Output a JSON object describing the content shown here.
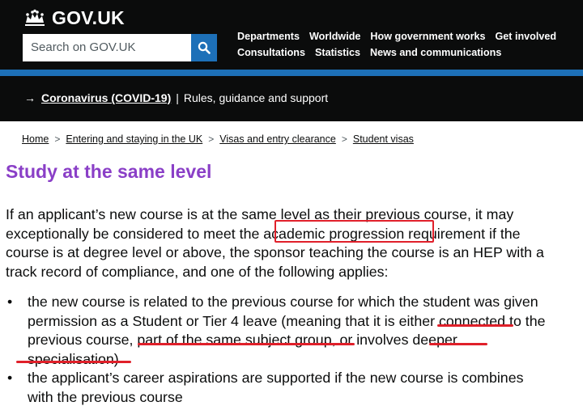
{
  "header": {
    "logo_text": "GOV.UK",
    "search_placeholder": "Search on GOV.UK",
    "nav_row1": [
      "Departments",
      "Worldwide",
      "How government works",
      "Get involved"
    ],
    "nav_row2": [
      "Consultations",
      "Statistics",
      "News and communications"
    ],
    "accent_blue": "#1d70b8"
  },
  "covid_banner": {
    "arrow": "→",
    "link": "Coronavirus (COVID-19)",
    "separator": "|",
    "text": "Rules, guidance and support"
  },
  "breadcrumb": [
    "Home",
    "Entering and staying in the UK",
    "Visas and entry clearance",
    "Student visas"
  ],
  "page_title": "Study at the same level",
  "paragraph_lines": [
    "If an applicant’s new course is at the same level as their previous course, it may",
    "exceptionally be considered to meet the academic progression requirement if the",
    "course is at degree level or above, the sponsor teaching the course is an HEP with a",
    "track record of compliance, and one of the following applies:"
  ],
  "bullets": [
    {
      "lines": [
        "the new course is related to the previous course for which the student was given",
        "permission as a Student or Tier 4 leave (meaning that it is either connected to the",
        "previous course, part of the same subject group, or involves deeper",
        "specialisation)"
      ]
    },
    {
      "lines": [
        "the applicant’s career aspirations are supported if the new course is combines",
        "with the previous course"
      ]
    }
  ],
  "annotation_color": "#e0202a",
  "title_color": "#8a3fc7"
}
